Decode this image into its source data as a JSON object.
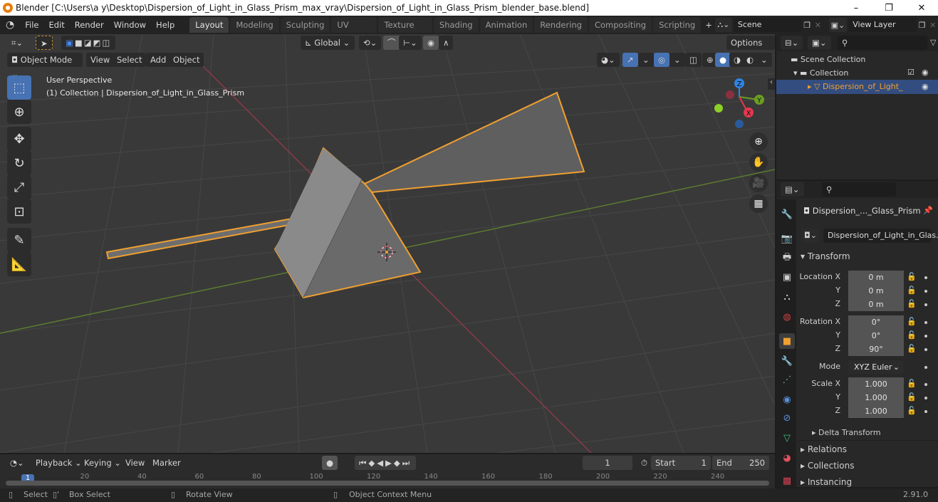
{
  "window": {
    "title": "Blender [C:\\Users\\a y\\Desktop\\Dispersion_of_Light_in_Glass_Prism_max_vray\\Dispersion_of_Light_in_Glass_Prism_blender_base.blend]",
    "minimize": "–",
    "maximize": "❐",
    "close": "✕"
  },
  "menu": [
    "File",
    "Edit",
    "Render",
    "Window",
    "Help"
  ],
  "workspaces": [
    "Layout",
    "Modeling",
    "Sculpting",
    "UV Editing",
    "Texture Paint",
    "Shading",
    "Animation",
    "Rendering",
    "Compositing",
    "Scripting"
  ],
  "active_workspace": "Layout",
  "add_workspace": "+",
  "scene": {
    "name": "Scene",
    "view_layer": "View Layer"
  },
  "viewport": {
    "transform_orientation": "Global",
    "options_label": "Options",
    "mode": "Object Mode",
    "header_menu": [
      "View",
      "Select",
      "Add",
      "Object"
    ],
    "overlay_title": "User Perspective",
    "overlay_subtitle": "(1) Collection | Dispersion_of_Light_in_Glass_Prism",
    "gizmo": {
      "x": "X",
      "y": "Y",
      "z": "Z",
      "x_color": "#e5384f",
      "y_color": "#6a9d22",
      "z_color": "#2f84e3"
    },
    "selection_color": "#f0a030"
  },
  "outliner": {
    "scene_collection": "Scene Collection",
    "collection": "Collection",
    "object": "Dispersion_of_Light_"
  },
  "properties": {
    "object_name": "Dispersion_..._Glass_Prism",
    "data_name": "Dispersion_of_Light_in_Glas...",
    "transform_label": "Transform",
    "location": {
      "label": "Location X",
      "x": "0 m",
      "y": "0 m",
      "z": "0 m"
    },
    "rotation": {
      "label": "Rotation X",
      "x": "0°",
      "y": "0°",
      "z": "90°"
    },
    "mode_label": "Mode",
    "mode_value": "XYZ Euler",
    "scale": {
      "label": "Scale X",
      "x": "1.000",
      "y": "1.000",
      "z": "1.000"
    },
    "axis_y": "Y",
    "axis_z": "Z",
    "delta_transform": "Delta Transform",
    "sections": [
      "Relations",
      "Collections",
      "Instancing"
    ]
  },
  "timeline": {
    "menus": [
      "Playback",
      "Keying",
      "View",
      "Marker"
    ],
    "current_frame": "1",
    "start_label": "Start",
    "start": "1",
    "end_label": "End",
    "end": "250",
    "ticks": [
      "1",
      "20",
      "40",
      "60",
      "80",
      "100",
      "120",
      "140",
      "160",
      "180",
      "200",
      "220",
      "240"
    ]
  },
  "status": {
    "select": "Select",
    "box_select": "Box Select",
    "rotate_view": "Rotate View",
    "context_menu": "Object Context Menu",
    "version": "2.91.0"
  }
}
